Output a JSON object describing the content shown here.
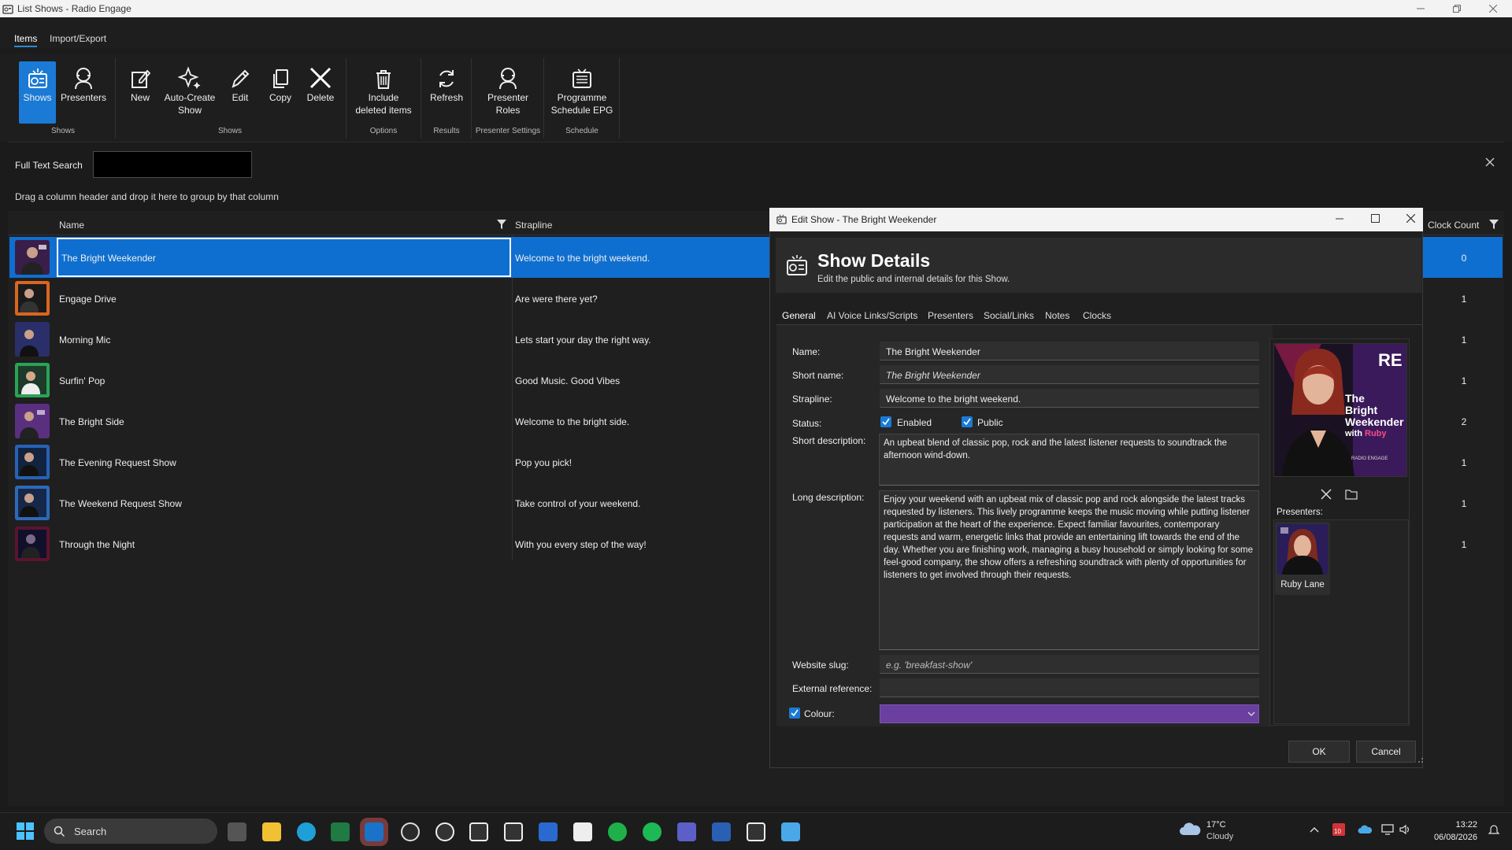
{
  "window": {
    "title": "List Shows - Radio Engage"
  },
  "ribbon": {
    "tabs": [
      "Items",
      "Import/Export"
    ],
    "buttons": {
      "shows": "Shows",
      "presenters": "Presenters",
      "new": "New",
      "auto_create_1": "Auto-Create",
      "auto_create_2": "Show",
      "edit": "Edit",
      "copy": "Copy",
      "delete": "Delete",
      "include_1": "Include",
      "include_2": "deleted items",
      "refresh": "Refresh",
      "roles_1": "Presenter",
      "roles_2": "Roles",
      "epg_1": "Programme",
      "epg_2": "Schedule EPG"
    },
    "groups": [
      "Shows",
      "Shows",
      "Options",
      "Results",
      "Presenter Settings",
      "Schedule"
    ]
  },
  "search": {
    "label": "Full Text Search",
    "value": ""
  },
  "grid": {
    "group_hint": "Drag a column header and drop it here to group by that column",
    "columns": {
      "name": "Name",
      "strapline": "Strapline",
      "clock_count": "Clock Count"
    },
    "rows": [
      {
        "name": "The Bright Weekender",
        "strapline": "Welcome to the bright weekend.",
        "clock_count": "0",
        "thumb_color": "#3a1e4a"
      },
      {
        "name": "Engage Drive",
        "strapline": "Are were there yet?",
        "clock_count": "1",
        "thumb_color": "#d9661f"
      },
      {
        "name": "Morning Mic",
        "strapline": "Lets start your day the right way.",
        "clock_count": "1",
        "thumb_color": "#2a2f6a"
      },
      {
        "name": "Surfin' Pop",
        "strapline": "Good Music. Good Vibes",
        "clock_count": "1",
        "thumb_color": "#2aa355"
      },
      {
        "name": "The Bright Side",
        "strapline": "Welcome to the bright side.",
        "clock_count": "2",
        "thumb_color": "#5a2f80"
      },
      {
        "name": "The Evening Request Show",
        "strapline": "Pop you pick!",
        "clock_count": "1",
        "thumb_color": "#2762b5"
      },
      {
        "name": "The Weekend Request Show",
        "strapline": "Take control of your weekend.",
        "clock_count": "1",
        "thumb_color": "#2e69b8"
      },
      {
        "name": "Through the Night",
        "strapline": "With you every step of the way!",
        "clock_count": "1",
        "thumb_color": "#5a1430"
      }
    ]
  },
  "dialog": {
    "title": "Edit Show -  The Bright Weekender",
    "header": "Show Details",
    "subheader": "Edit the public and internal details for this Show.",
    "tabs": [
      "General",
      "AI Voice Links/Scripts",
      "Presenters",
      "Social/Links",
      "Notes",
      "Clocks"
    ],
    "labels": {
      "name": "Name:",
      "short_name": "Short name:",
      "strapline": "Strapline:",
      "status": "Status:",
      "short_desc": "Short description:",
      "long_desc": "Long description:",
      "slug": "Website slug:",
      "ext_ref": "External reference:",
      "colour": "Colour:"
    },
    "values": {
      "name": "The Bright Weekender",
      "short_name": "The Bright Weekender",
      "strapline": "Welcome to the bright weekend.",
      "enabled": "Enabled",
      "public": "Public",
      "short_desc": "An upbeat blend of classic pop, rock and the latest listener requests to soundtrack the afternoon wind-down.",
      "long_desc": "Enjoy your weekend with an upbeat mix of classic pop and rock alongside the latest tracks requested by listeners. This lively programme keeps the music moving while putting listener participation at the heart of the experience. Expect familiar favourites, contemporary requests and warm, energetic links that provide an entertaining lift towards the end of the day. Whether you are finishing work, managing a busy household or simply looking for some feel-good company, the show offers a refreshing soundtrack with plenty of opportunities for listeners to get involved through their requests.",
      "slug_placeholder": "e.g. 'breakfast-show'",
      "ext_ref": "",
      "colour_hex": "#6a3fa0"
    },
    "image_text": {
      "the": "The",
      "bright": "Bright",
      "weekender": "Weekender",
      "with": "with",
      "ruby": "Ruby",
      "brand": "RE",
      "footer": "RADIO ENGAGE"
    },
    "presenters_label": "Presenters:",
    "presenter_name": "Ruby Lane",
    "ok": "OK",
    "cancel": "Cancel"
  },
  "taskbar": {
    "search": "Search",
    "weather_temp": "17°C",
    "weather_desc": "Cloudy",
    "time": "13:22",
    "date": "06/08/2026",
    "badge": "10"
  },
  "colors": {
    "accent": "#1a7ad6",
    "selection": "#0f6fd0",
    "colour_field": "#6a3fa0"
  }
}
